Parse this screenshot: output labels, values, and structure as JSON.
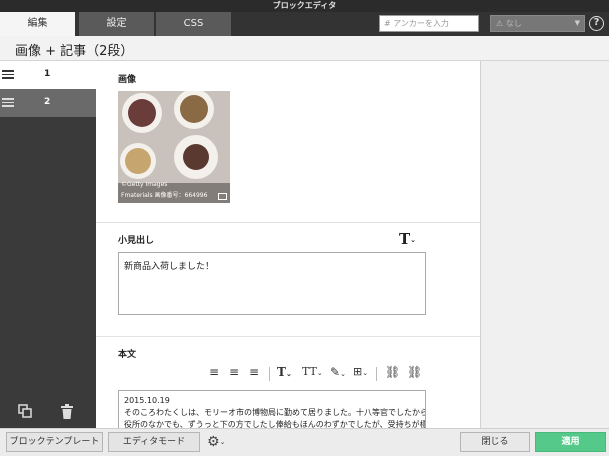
{
  "window": {
    "title": "ブロックエディタ"
  },
  "tabs": [
    {
      "label": "編集",
      "active": true
    },
    {
      "label": "設定",
      "active": false
    },
    {
      "label": "CSS",
      "active": false
    }
  ],
  "anchor": {
    "placeholder": "アンカーを入力",
    "icon": "hash-icon"
  },
  "anchor_select": {
    "value": "なし"
  },
  "help": {
    "label": "?"
  },
  "page": {
    "title": "画像 + 記事（2段）"
  },
  "sidebar": {
    "items": [
      {
        "label": "1",
        "selected": false
      },
      {
        "label": "2",
        "selected": true
      }
    ]
  },
  "image_section": {
    "label": "画像",
    "caption1": "©Getty Images",
    "caption2": "Fmaterials 画像番号：664996"
  },
  "subheading_section": {
    "label": "小見出し",
    "text_style_icon": "T",
    "value": "新商品入荷しました！"
  },
  "body_section": {
    "label": "本文",
    "lines": [
      "2015.10.19",
      "そのころわたくしは、モリーオ市の博物局に勤めて居りました。十八等官でしたから",
      "役所のなかでも、ずうっと下の方でしたし俸給もほんのわずかでしたが、受持ちが標"
    ]
  },
  "footer": {
    "template_button": "ブロックテンプレート",
    "editor_mode_button": "エディタモード",
    "close_button": "閉じる",
    "apply_button": "適用"
  },
  "colors": {
    "accent": "#55c989",
    "dark": "#333333"
  }
}
